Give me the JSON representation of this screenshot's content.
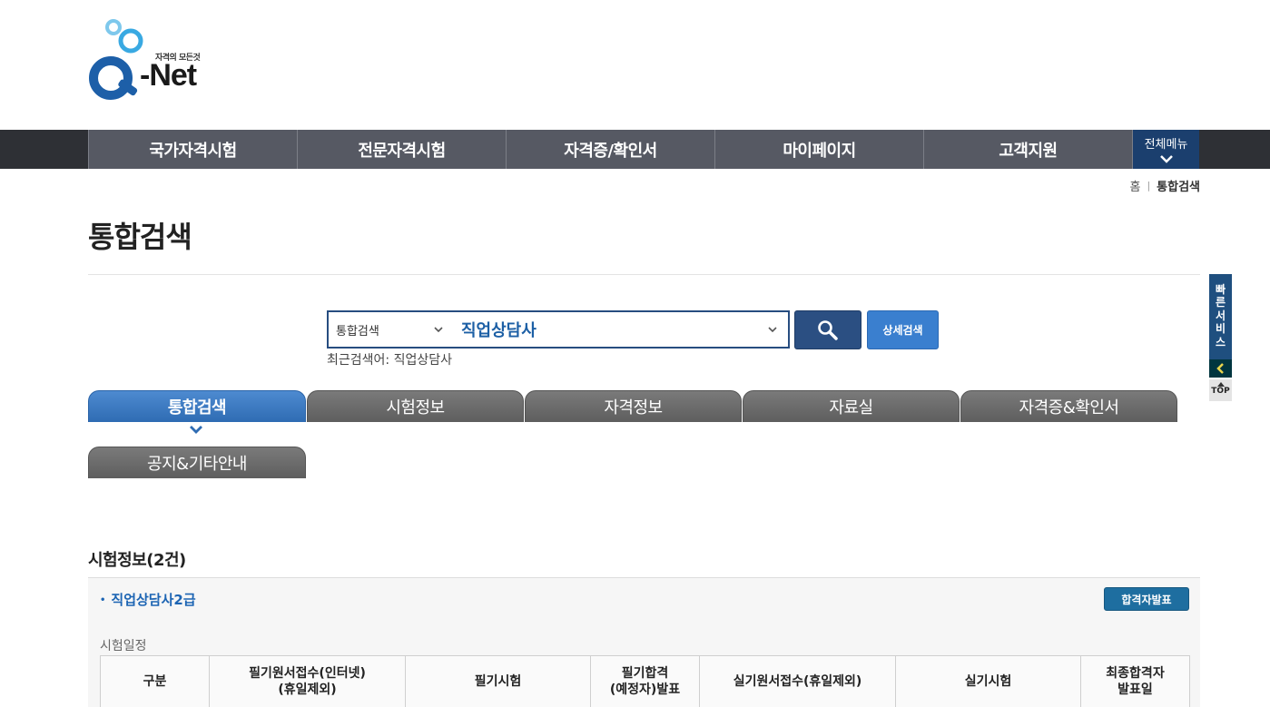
{
  "logo": {
    "tagline": "자격의 모든것",
    "name": "-Net"
  },
  "gnb": {
    "items": [
      "국가자격시험",
      "전문자격시험",
      "자격증/확인서",
      "마이페이지",
      "고객지원"
    ],
    "all_menu": "전체메뉴"
  },
  "breadcrumb": {
    "home": "홈",
    "current": "통합검색"
  },
  "page_title": "통합검색",
  "search": {
    "category": "통합검색",
    "query": "직업상담사",
    "detail_button": "상세검색",
    "recent_label": "최근검색어:",
    "recent_term": "직업상담사"
  },
  "tabs": [
    "통합검색",
    "시험정보",
    "자격정보",
    "자료실",
    "자격증&확인서",
    "공지&기타안내"
  ],
  "result": {
    "section_title": "시험정보(2건)",
    "item_title": "직업상담사2급",
    "pass_button": "합격자발표",
    "schedule_label": "시험일정",
    "table_headers": [
      "구분",
      "필기원서접수(인터넷)\n(휴일제외)",
      "필기시험",
      "필기합격\n(예정자)발표",
      "실기원서접수(휴일제외)",
      "실기시험",
      "최종합격자\n발표일"
    ]
  },
  "side": {
    "quick_service": "빠른서비스",
    "top": "TOP"
  },
  "colors": {
    "nav": "#565963",
    "nav_cap": "#2e3035",
    "primary": "#2b4f82",
    "active_tab": "#2f6cb3",
    "link": "#1c64b3"
  }
}
